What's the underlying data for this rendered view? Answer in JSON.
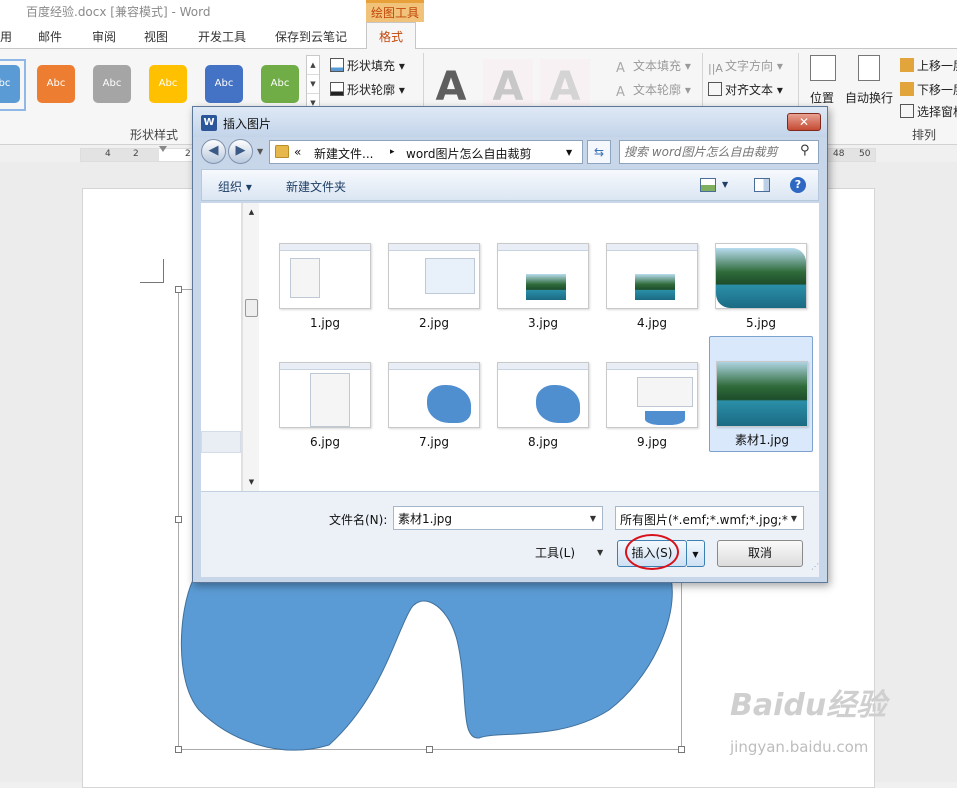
{
  "window": {
    "title": "百度经验.docx [兼容模式] - Word",
    "contextual_tab_group": "绘图工具"
  },
  "ribbon_tabs": [
    "用",
    "邮件",
    "审阅",
    "视图",
    "开发工具",
    "保存到云笔记",
    "格式"
  ],
  "ribbon": {
    "shape_styles": [
      {
        "label": "Abc",
        "color": "#5b9bd5"
      },
      {
        "label": "Abc",
        "color": "#ed7d31"
      },
      {
        "label": "Abc",
        "color": "#a5a5a5"
      },
      {
        "label": "Abc",
        "color": "#ffc000"
      },
      {
        "label": "Abc",
        "color": "#4472c4"
      },
      {
        "label": "Abc",
        "color": "#70ad47"
      }
    ],
    "shape_fill": "形状填充",
    "shape_outline": "形状轮廓",
    "shape_styles_group": "形状样式",
    "wordart_letter": "A",
    "text_fill": "文本填充",
    "text_outline": "文本轮廓",
    "text_direction": "文字方向",
    "align_text": "对齐文本",
    "position": "位置",
    "wrap_text": "自动换行",
    "bring_forward": "上移一层",
    "send_backward": "下移一层",
    "selection_pane": "选择窗格",
    "arrange_group": "排列"
  },
  "ruler_numbers": [
    "4",
    "2",
    "2",
    "48",
    "50"
  ],
  "dialog": {
    "title": "插入图片",
    "close_label": "✕",
    "breadcrumbs": [
      "«",
      "新建文件...",
      "▸",
      "word图片怎么自由裁剪"
    ],
    "search_placeholder": "搜索 word图片怎么自由裁剪",
    "toolbar": {
      "organize": "组织",
      "new_folder": "新建文件夹",
      "help": "?"
    },
    "files": [
      {
        "name": "1.jpg",
        "kind": "doc"
      },
      {
        "name": "2.jpg",
        "kind": "doc-dialog"
      },
      {
        "name": "3.jpg",
        "kind": "doc-lake"
      },
      {
        "name": "4.jpg",
        "kind": "doc-lake"
      },
      {
        "name": "5.jpg",
        "kind": "lake-crop"
      },
      {
        "name": "6.jpg",
        "kind": "doc-menu"
      },
      {
        "name": "7.jpg",
        "kind": "doc-blob"
      },
      {
        "name": "8.jpg",
        "kind": "doc-blob"
      },
      {
        "name": "9.jpg",
        "kind": "doc-panel"
      },
      {
        "name": "素材1.jpg",
        "kind": "lake",
        "selected": true
      }
    ],
    "filename_label": "文件名(N):",
    "filename_value": "素材1.jpg",
    "filter_value": "所有图片(*.emf;*.wmf;*.jpg;*.jp",
    "tools_label": "工具(L)",
    "insert_label": "插入(S)",
    "cancel_label": "取消"
  },
  "watermark": {
    "main": "Baidu经验",
    "sub": "jingyan.baidu.com"
  },
  "colors": {
    "shape_blue": "#5b9bd5",
    "accent_orange": "#c2470a",
    "highlight_circle": "#d8121a"
  }
}
